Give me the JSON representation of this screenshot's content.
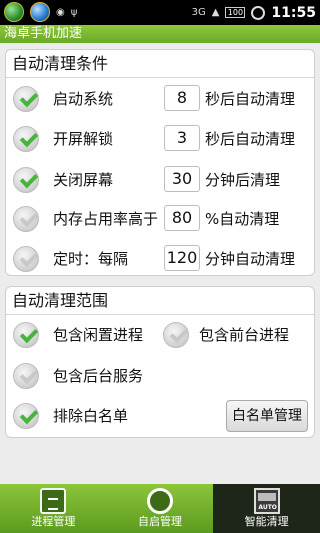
{
  "status": {
    "time": "11:55",
    "network": "3G",
    "battery": "100"
  },
  "app": {
    "title": "海卓手机加速"
  },
  "auto_clean_conditions": {
    "title": "自动清理条件",
    "rows": [
      {
        "label": "启动系统",
        "value": "8",
        "suffix": "秒后自动清理",
        "checked": true
      },
      {
        "label": "开屏解锁",
        "value": "3",
        "suffix": "秒后自动清理",
        "checked": true
      },
      {
        "label": "关闭屏幕",
        "value": "30",
        "suffix": "分钟后清理",
        "checked": true
      },
      {
        "label": "内存占用率高于",
        "value": "80",
        "suffix": "%自动清理",
        "checked": false
      },
      {
        "label": "定时：每隔",
        "value": "120",
        "suffix": "分钟自动清理",
        "checked": false
      }
    ]
  },
  "auto_clean_scope": {
    "title": "自动清理范围",
    "items": [
      {
        "label": "包含闲置进程",
        "checked": true
      },
      {
        "label": "包含前台进程",
        "checked": false
      },
      {
        "label": "包含后台服务",
        "checked": false
      },
      {
        "label": "排除白名单",
        "checked": true
      }
    ],
    "whitelist_button": "白名单管理"
  },
  "tabs": [
    {
      "label": "进程管理",
      "icon": "clipboard-icon",
      "active": false
    },
    {
      "label": "自启管理",
      "icon": "rocket-icon",
      "active": false
    },
    {
      "label": "智能清理",
      "icon": "auto-icon",
      "active": true,
      "icon_text": "AUTO"
    }
  ],
  "colors": {
    "accent": "#6aa827",
    "check": "#47b43a",
    "active_tab": "#1e2619"
  }
}
